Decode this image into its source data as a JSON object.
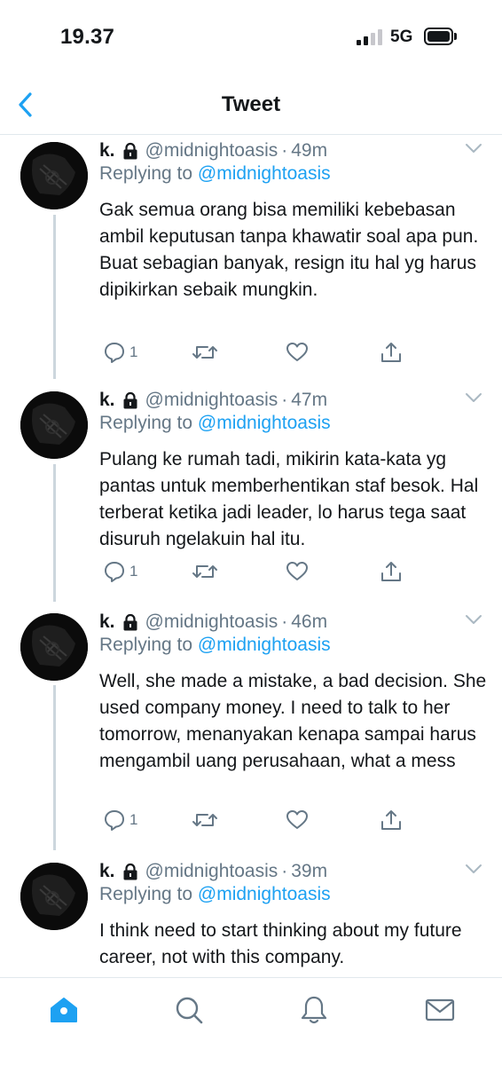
{
  "status_bar": {
    "time": "19.37",
    "network": "5G"
  },
  "header": {
    "title": "Tweet",
    "back_icon": "chevron-left-icon"
  },
  "colors": {
    "accent": "#1da1f2",
    "secondary_text": "#657786",
    "primary_text": "#14171a",
    "divider": "#e1e8ed"
  },
  "tweets": [
    {
      "name": "k.",
      "handle": "@midnightoasis",
      "time": "49m",
      "replying_prefix": "Replying to ",
      "replying_to": "@midnightoasis",
      "text": "Gak semua orang bisa memiliki kebebasan ambil keputusan tanpa khawatir soal apa pun. Buat sebagian banyak, resign itu hal yg harus dipikirkan sebaik mungkin.",
      "reply_count": "1"
    },
    {
      "name": "k.",
      "handle": "@midnightoasis",
      "time": "47m",
      "replying_prefix": "Replying to ",
      "replying_to": "@midnightoasis",
      "text": "Pulang ke rumah tadi, mikirin kata-kata yg pantas untuk memberhentikan staf besok. Hal terberat ketika jadi leader, lo harus tega saat disuruh ngelakuin hal itu.",
      "reply_count": "1"
    },
    {
      "name": "k.",
      "handle": "@midnightoasis",
      "time": "46m",
      "replying_prefix": "Replying to ",
      "replying_to": "@midnightoasis",
      "text": "Well, she made a mistake, a bad decision. She used company money. I need to talk to her tomorrow, menanyakan kenapa sampai harus mengambil uang perusahaan, what a mess",
      "reply_count": "1"
    },
    {
      "name": "k.",
      "handle": "@midnightoasis",
      "time": "39m",
      "replying_prefix": "Replying to ",
      "replying_to": "@midnightoasis",
      "text": "I think need to start thinking about my future career, not with this company.",
      "reply_count": ""
    }
  ],
  "tab_bar": {
    "items": [
      "home-icon",
      "search-icon",
      "bell-icon",
      "mail-icon"
    ],
    "active": "home-icon"
  }
}
